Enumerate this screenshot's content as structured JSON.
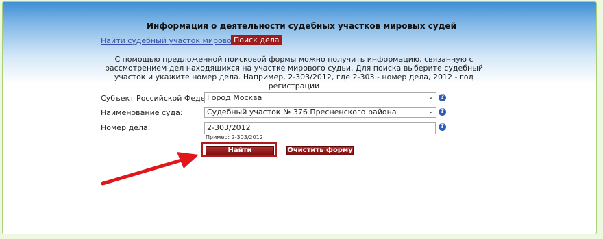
{
  "page": {
    "title": "Информация о деятельности судебных участков мировых судей"
  },
  "tabs": {
    "find_plot": "Найти судебный участок мирового судьи",
    "case_search": "Поиск дела"
  },
  "intro_text": "С помощью предложенной поисковой формы можно получить информацию, связанную с рассмотрением дел находящихся на участке мирового судьи. Для поиска выберите судебный участок и укажите номер дела. Например, 2-303/2012, где 2-303 - номер дела, 2012 - год регистрации",
  "form": {
    "subject_label": "Субъект Российской Федерации:",
    "subject_value": "Город Москва",
    "court_label": "Наименование суда:",
    "court_value": "Судебный участок № 376 Пресненского района",
    "case_label": "Номер дела:",
    "case_value": "2-303/2012",
    "case_hint": "Пример: 2-303/2012",
    "help_glyph": "?"
  },
  "buttons": {
    "find": "Найти",
    "clear": "Очистить форму"
  },
  "annotation": {
    "arrow_color": "#e0161b",
    "highlight_color": "#b11a1a"
  },
  "icons": {
    "dropdown": "chevron-down-icon",
    "help": "help-icon",
    "arrow": "arrow-icon"
  }
}
